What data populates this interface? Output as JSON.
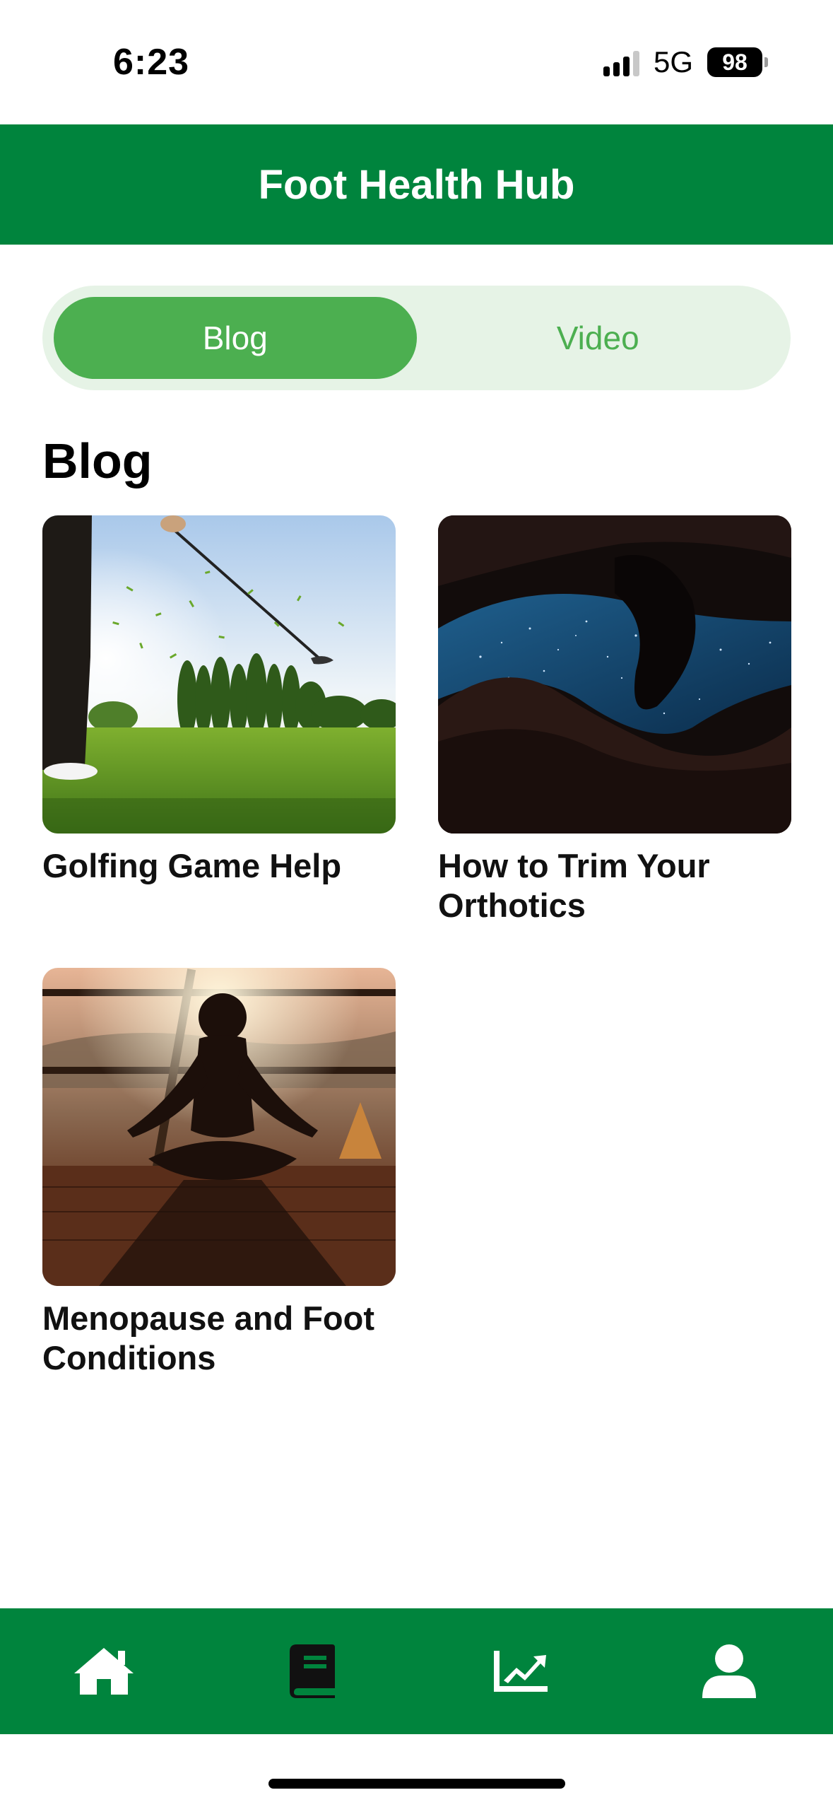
{
  "status_bar": {
    "time": "6:23",
    "network": "5G",
    "battery": "98"
  },
  "header": {
    "title": "Foot Health Hub",
    "background": "#00843d"
  },
  "segment": {
    "tabs": [
      {
        "label": "Blog",
        "active": true
      },
      {
        "label": "Video",
        "active": false
      }
    ],
    "active_color": "#4caf50"
  },
  "section": {
    "title": "Blog"
  },
  "posts": [
    {
      "title": "Golfing Game Help",
      "image": "golf-swing-photo"
    },
    {
      "title": "How to Trim Your Orthotics",
      "image": "canyon-night-sky-photo"
    },
    {
      "title": "Menopause and Foot Conditions",
      "image": "meditation-sunset-photo"
    }
  ],
  "bottom_nav": {
    "items": [
      {
        "name": "home",
        "icon": "home-icon",
        "active": false
      },
      {
        "name": "blog",
        "icon": "book-icon",
        "active": true
      },
      {
        "name": "progress",
        "icon": "chart-line-icon",
        "active": false
      },
      {
        "name": "profile",
        "icon": "user-icon",
        "active": false
      }
    ]
  }
}
